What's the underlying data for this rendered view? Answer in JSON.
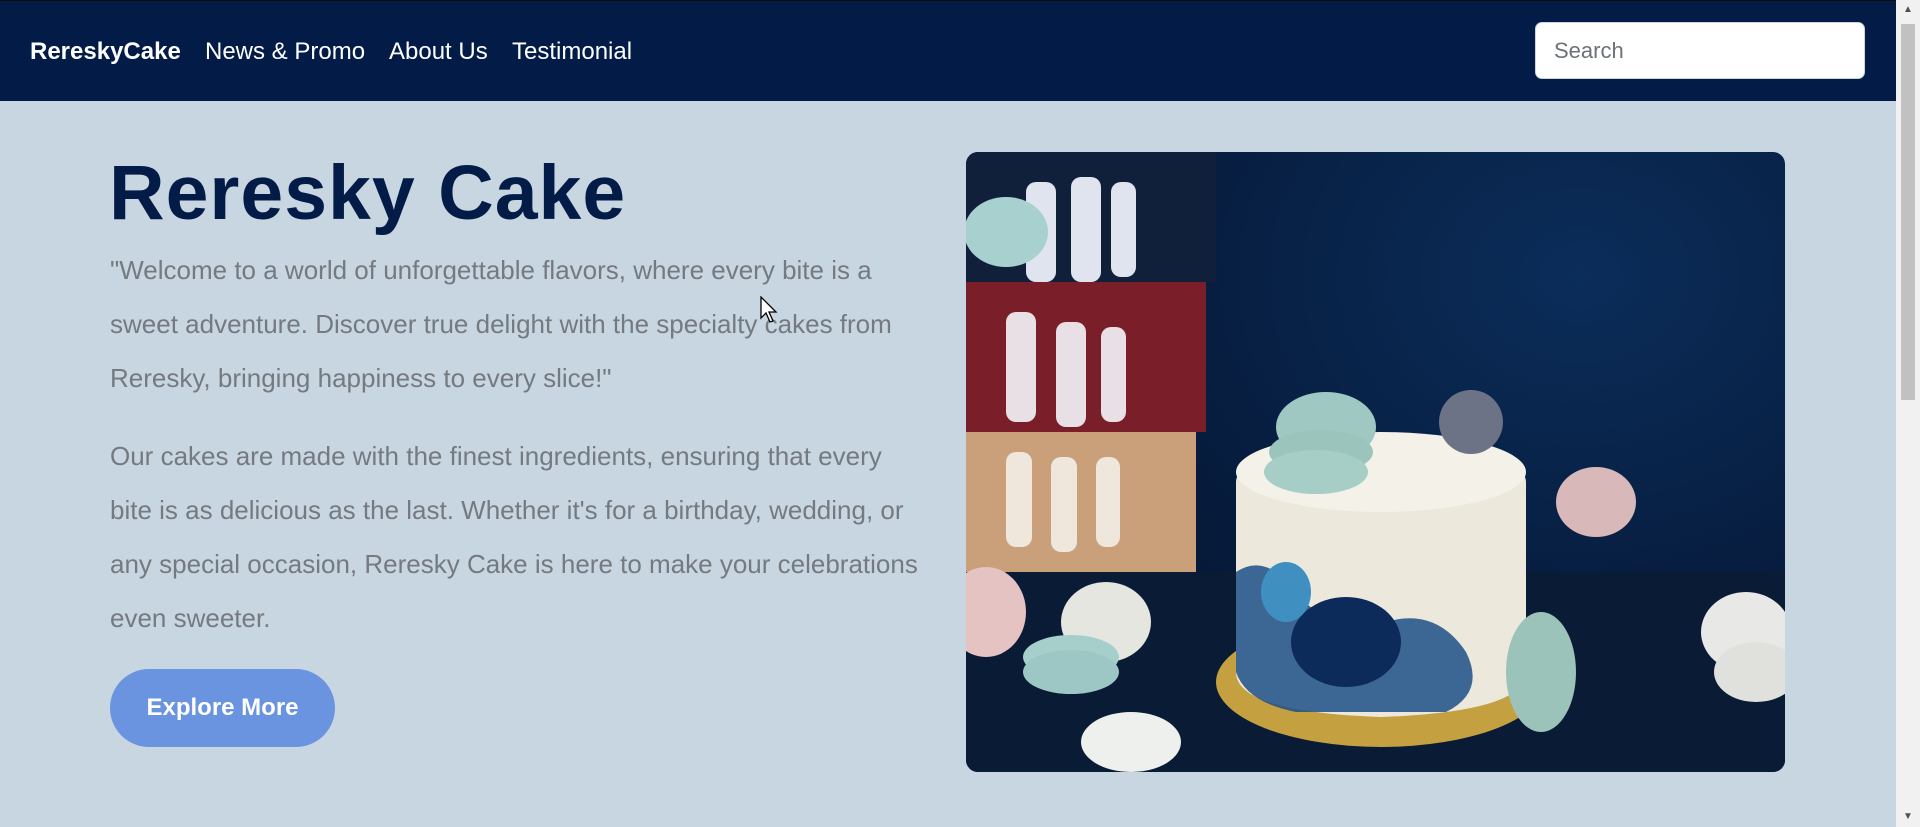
{
  "navbar": {
    "brand": "RereskyCake",
    "links": [
      "News & Promo",
      "About Us",
      "Testimonial"
    ],
    "search_placeholder": "Search",
    "background": "#021b47"
  },
  "hero": {
    "title": "Reresky Cake",
    "paragraph1": "\"Welcome to a world of unforgettable flavors, where every bite is a sweet adventure. Discover true delight with the specialty cakes from Reresky, bringing happiness to every slice!\"",
    "paragraph2": "Our cakes are made with the finest ingredients, ensuring that every bite is as delicious as the last. Whether it's for a birthday, wedding, or any special occasion, Reresky Cake is here to make your celebrations even sweeter.",
    "button": "Explore More",
    "image_subject": "cake-with-macarons-photo"
  },
  "colors": {
    "page_background": "#c8d6e1",
    "title": "#021b47",
    "body_text": "#747a80",
    "button": "#6a93e0"
  }
}
